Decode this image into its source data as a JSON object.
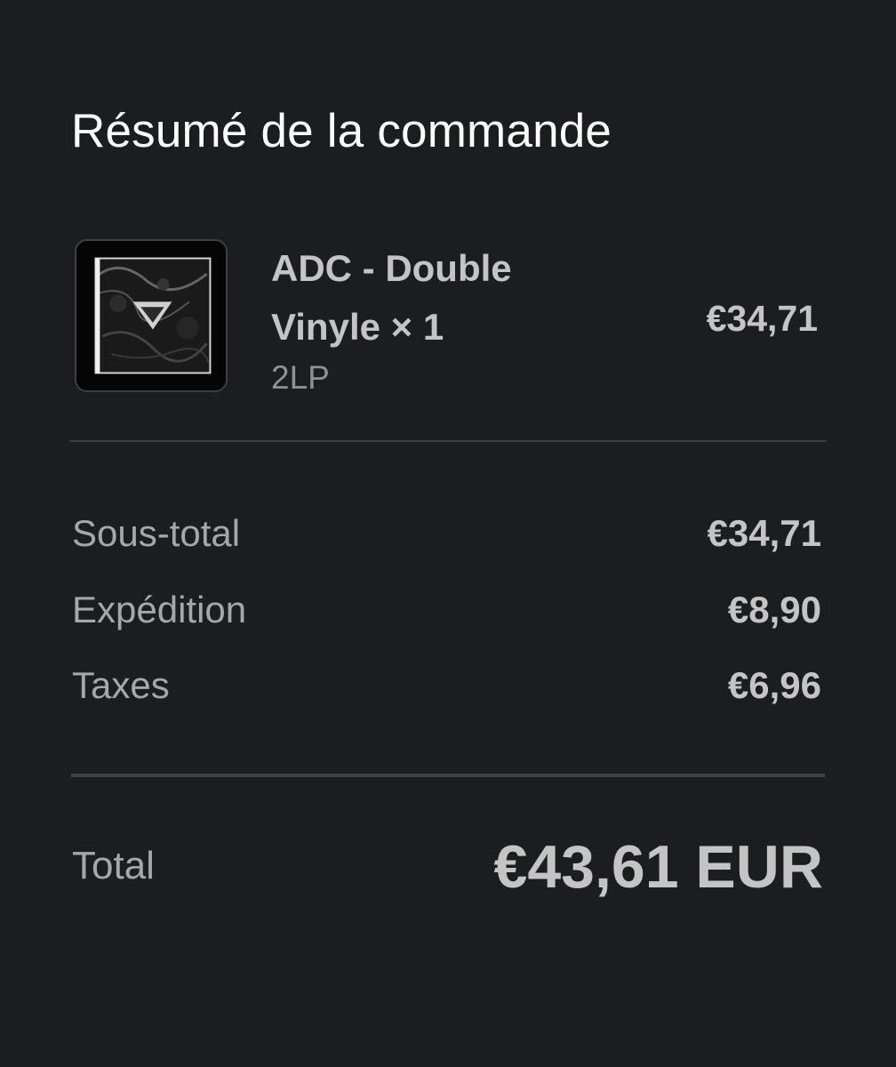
{
  "summary": {
    "title": "Résumé de la commande"
  },
  "item": {
    "name_line1": "ADC - Double",
    "name_line2": "Vinyle × 1",
    "variant": "2LP",
    "price": "€34,71"
  },
  "totals": {
    "subtotal_label": "Sous-total",
    "subtotal_value": "€34,71",
    "shipping_label": "Expédition",
    "shipping_value": "€8,90",
    "taxes_label": "Taxes",
    "taxes_value": "€6,96",
    "total_label": "Total",
    "total_value": "€43,61 EUR"
  },
  "icons": {
    "thumbnail": "album-cover-image"
  },
  "colors": {
    "background": "#1b1d20",
    "title": "#ffffff",
    "text": "#c4c4c4",
    "muted": "#a6a7a8",
    "divider": "#3a3d40"
  }
}
